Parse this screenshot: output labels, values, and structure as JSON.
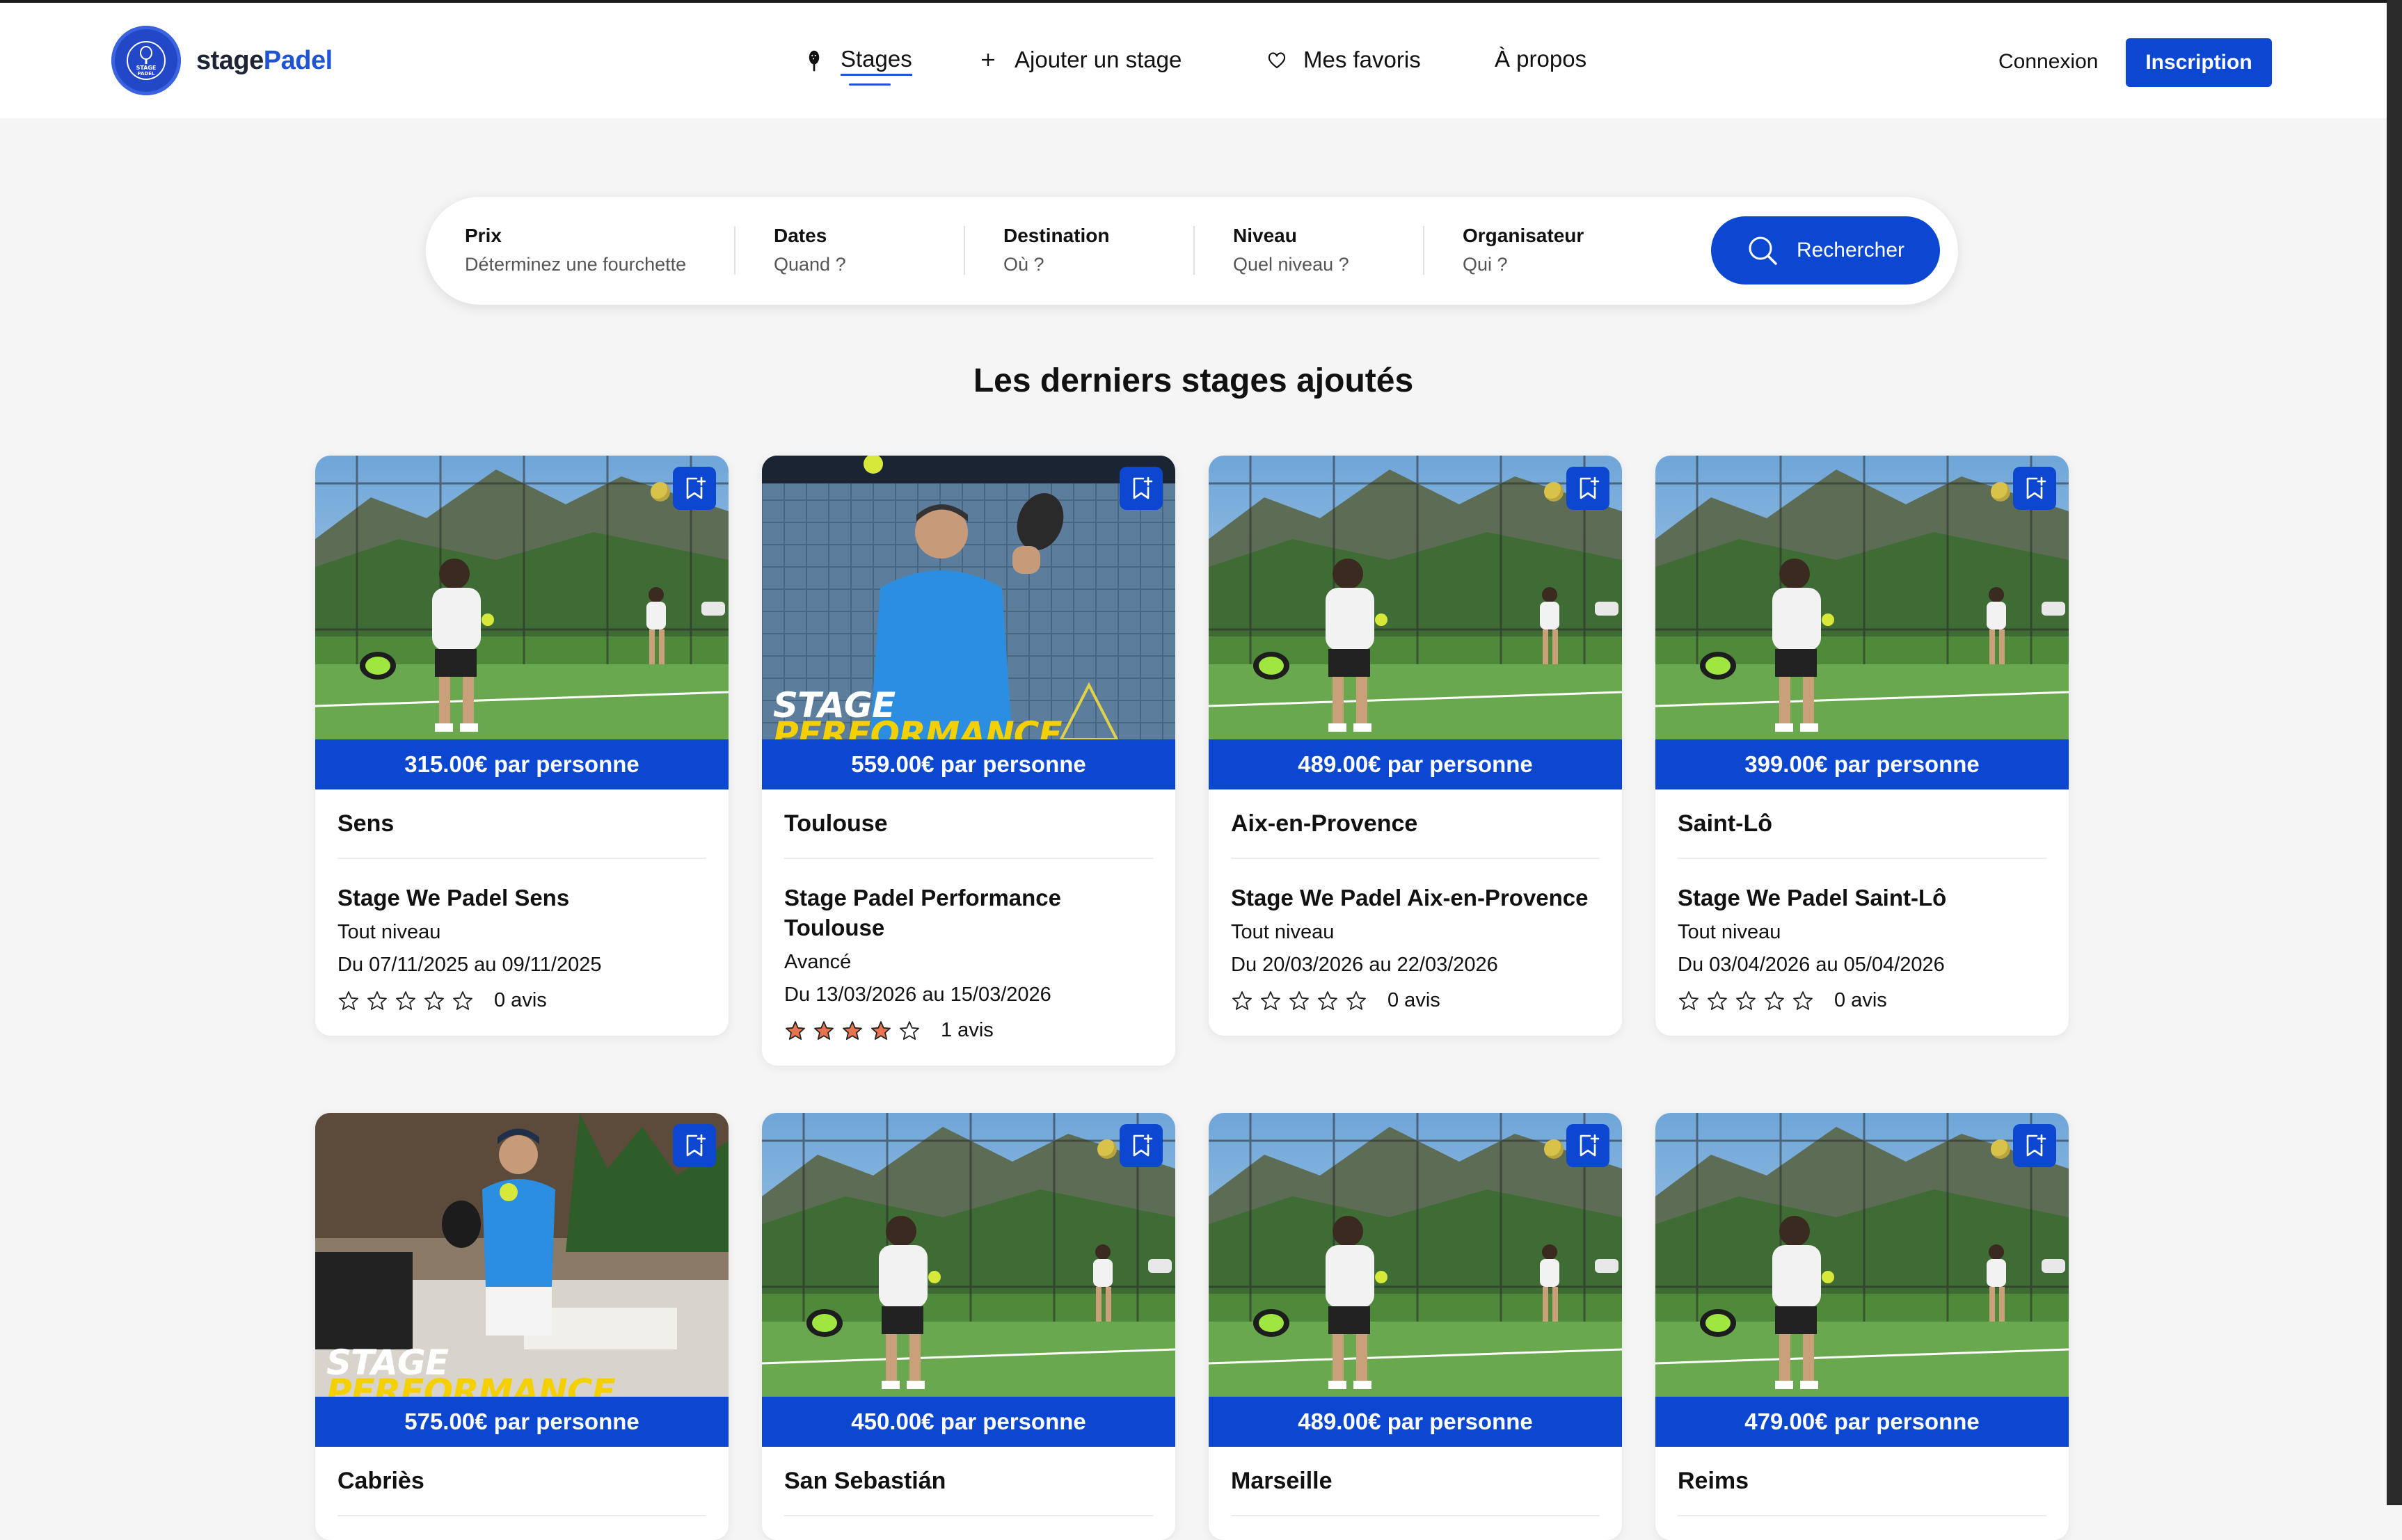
{
  "brand": {
    "part1": "stage",
    "part2": "Padel",
    "badge_text": "STAGE PADEL"
  },
  "nav": [
    {
      "label": "Stages",
      "icon": "padel-racket-icon"
    },
    {
      "label": "Ajouter un stage",
      "icon": "plus-icon"
    },
    {
      "label": "Mes favoris",
      "icon": "heart-icon"
    },
    {
      "label": "À propos",
      "icon": ""
    }
  ],
  "auth": {
    "login": "Connexion",
    "signup": "Inscription"
  },
  "search": {
    "fields": [
      {
        "title": "Prix",
        "placeholder": "Déterminez une fourchette"
      },
      {
        "title": "Dates",
        "placeholder": "Quand ?"
      },
      {
        "title": "Destination",
        "placeholder": "Où ?"
      },
      {
        "title": "Niveau",
        "placeholder": "Quel niveau ?"
      },
      {
        "title": "Organisateur",
        "placeholder": "Qui ?"
      }
    ],
    "button": "Rechercher"
  },
  "section_title": "Les derniers stages ajoutés",
  "cards": [
    {
      "price": "315.00€ par personne",
      "city": "Sens",
      "title": "Stage We Padel Sens",
      "level": "Tout niveau",
      "dates": "Du 07/11/2025 au 09/11/2025",
      "stars": 0,
      "reviews": "0 avis",
      "image": "court-outdoor"
    },
    {
      "price": "559.00€ par personne",
      "city": "Toulouse",
      "title": "Stage Padel Performance Toulouse",
      "level": "Avancé",
      "dates": "Du 13/03/2026 au 15/03/2026",
      "stars": 4,
      "reviews": "1 avis",
      "image": "performance-indoor",
      "overlay_1": "STAGE",
      "overlay_2": "PERFORMANCE"
    },
    {
      "price": "489.00€ par personne",
      "city": "Aix-en-Provence",
      "title": "Stage We Padel Aix-en-Provence",
      "level": "Tout niveau",
      "dates": "Du 20/03/2026 au 22/03/2026",
      "stars": 0,
      "reviews": "0 avis",
      "image": "court-outdoor"
    },
    {
      "price": "399.00€ par personne",
      "city": "Saint-Lô",
      "title": "Stage We Padel Saint-Lô",
      "level": "Tout niveau",
      "dates": "Du 03/04/2026 au 05/04/2026",
      "stars": 0,
      "reviews": "0 avis",
      "image": "court-outdoor"
    },
    {
      "price": "575.00€ par personne",
      "city": "Cabriès",
      "image": "performance-outdoor",
      "overlay_1": "STAGE",
      "overlay_2": "PERFORMANCE"
    },
    {
      "price": "450.00€ par personne",
      "city": "San Sebastián",
      "image": "court-outdoor"
    },
    {
      "price": "489.00€ par personne",
      "city": "Marseille",
      "image": "court-outdoor"
    },
    {
      "price": "479.00€ par personne",
      "city": "Reims",
      "image": "court-outdoor"
    }
  ],
  "colors": {
    "primary": "#0b47d1",
    "brand_accent": "#1f54d6",
    "star_filled": "#e8734f"
  }
}
